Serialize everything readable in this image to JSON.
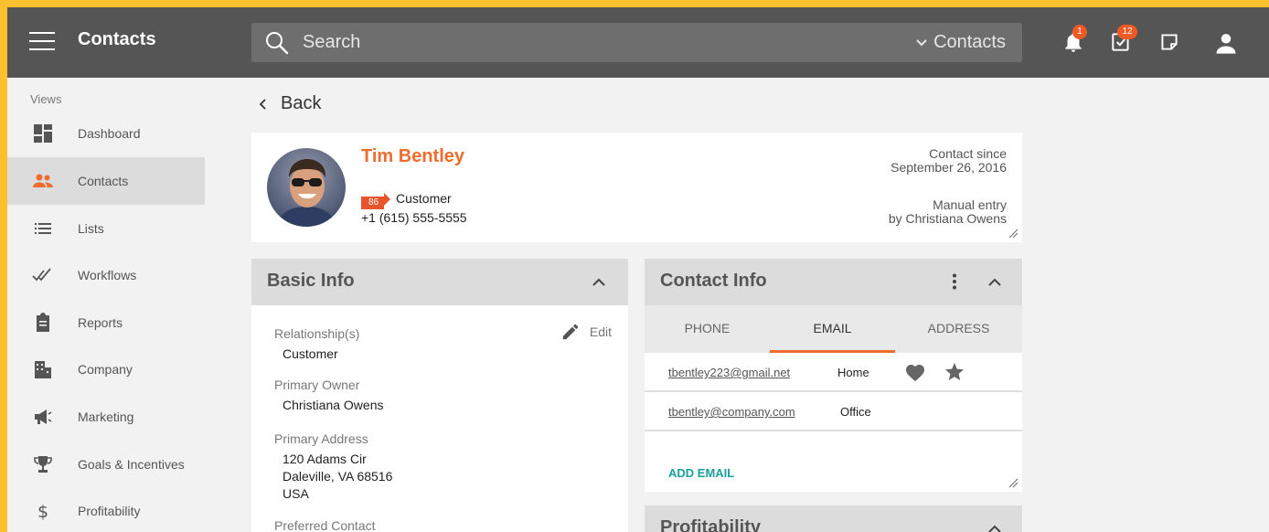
{
  "header": {
    "app_title": "Contacts",
    "search_placeholder": "Search",
    "search_scope": "Contacts",
    "notifications_count": "1",
    "tasks_count": "12"
  },
  "sidebar": {
    "section_label": "Views",
    "items": [
      {
        "label": "Dashboard",
        "icon": "dashboard-icon"
      },
      {
        "label": "Contacts",
        "icon": "people-icon"
      },
      {
        "label": "Lists",
        "icon": "list-icon"
      },
      {
        "label": "Workflows",
        "icon": "double-check-icon"
      },
      {
        "label": "Reports",
        "icon": "clipboard-icon"
      },
      {
        "label": "Company",
        "icon": "building-icon"
      },
      {
        "label": "Marketing",
        "icon": "megaphone-icon"
      },
      {
        "label": "Goals & Incentives",
        "icon": "trophy-icon"
      },
      {
        "label": "Profitability",
        "icon": "dollar-icon"
      }
    ],
    "active": "Contacts"
  },
  "back_label": "Back",
  "contact": {
    "name": "Tim Bentley",
    "score": "86",
    "relationship": "Customer",
    "phone": "+1 (615) 555-5555",
    "contact_since_label": "Contact since",
    "contact_since_date": "September 26, 2016",
    "source_label": "Manual entry",
    "source_by": "by Christiana Owens"
  },
  "basic_info": {
    "title": "Basic Info",
    "edit_label": "Edit",
    "fields": [
      {
        "label": "Relationship(s)",
        "value": "Customer"
      },
      {
        "label": "Primary Owner",
        "value": "Christiana Owens"
      },
      {
        "label": "Primary Address",
        "lines": [
          "120 Adams Cir",
          "Daleville, VA 68516",
          "USA"
        ]
      },
      {
        "label": "Preferred Contact",
        "value": ""
      }
    ]
  },
  "contact_info": {
    "title": "Contact Info",
    "tabs": [
      "PHONE",
      "EMAIL",
      "ADDRESS"
    ],
    "active_tab": "EMAIL",
    "emails": [
      {
        "address": "tbentley223@gmail.net",
        "type": "Home",
        "favorite": true,
        "primary": true
      },
      {
        "address": "tbentley@company.com",
        "type": "Office",
        "favorite": false,
        "primary": false
      }
    ],
    "add_label": "ADD EMAIL"
  },
  "profitability": {
    "title": "Profitability"
  },
  "colors": {
    "topbar": "#555555",
    "accent": "#ef6c2f",
    "badge": "#ef5a24",
    "link": "#1a9e9e",
    "background": "#fbc02d"
  }
}
